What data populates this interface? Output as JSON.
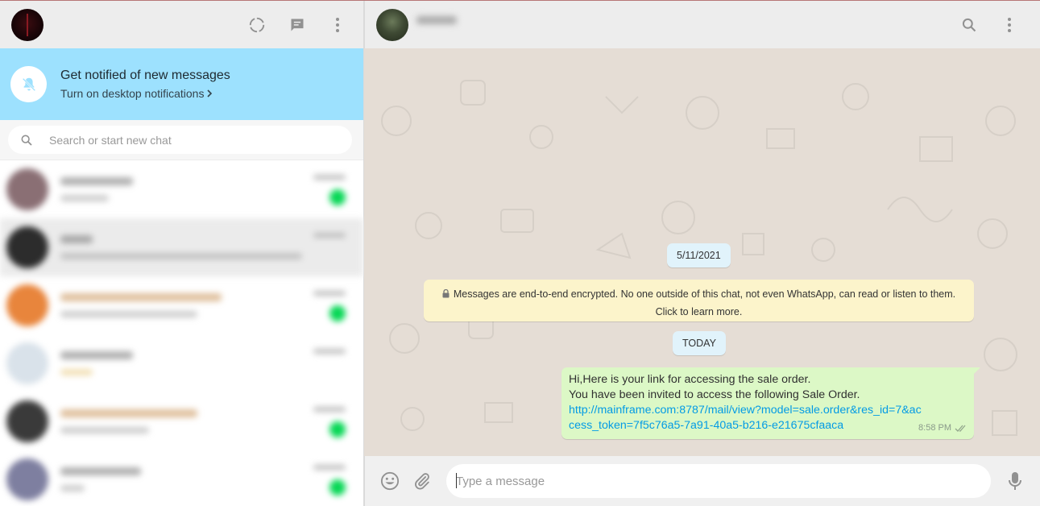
{
  "left": {
    "notification": {
      "title": "Get notified of new messages",
      "link": "Turn on desktop notifications"
    },
    "search": {
      "placeholder": "Search or start new chat"
    },
    "chats": [
      {
        "avatar_color": "#8a6f74"
      },
      {
        "avatar_color": "#2c2c2c"
      },
      {
        "avatar_color": "#e8853c"
      },
      {
        "avatar_color": "#d9e2ea"
      },
      {
        "avatar_color": "#3a3a3a"
      },
      {
        "avatar_color": "#7e7fa0"
      }
    ]
  },
  "right": {
    "date_pill": "5/11/2021",
    "encryption_note": "Messages are end-to-end encrypted. No one outside of this chat, not even WhatsApp, can read or listen to them. Click to learn more.",
    "today_pill": "TODAY",
    "message": {
      "line1": "Hi,Here is your link for accessing the sale order.",
      "line2": "You have been invited to access the following Sale Order.",
      "link": "http://mainframe.com:8787/mail/view?model=sale.order&res_id=7&access_token=7f5c76a5-7a91-40a5-b216-e21675cfaaca",
      "time": "8:58 PM"
    },
    "compose": {
      "placeholder": "Type a message"
    }
  },
  "colors": {
    "notification_bg": "#9de1fe",
    "chat_bg": "#e5ddd5",
    "outgoing_bubble": "#dcf8c6",
    "encryption_bg": "#fcf4cb",
    "date_pill_bg": "#e1f3fb",
    "link": "#039be5",
    "unread_badge": "#06d755"
  }
}
